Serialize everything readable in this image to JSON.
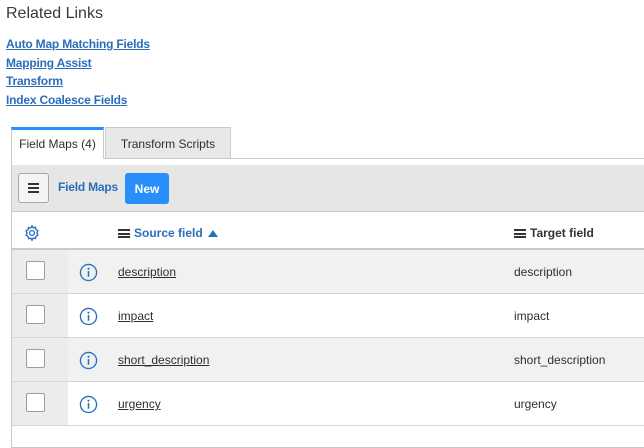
{
  "related": {
    "title": "Related Links",
    "links": [
      "Auto Map Matching Fields",
      "Mapping Assist",
      "Transform",
      "Index Coalesce Fields"
    ]
  },
  "tabs": [
    {
      "label": "Field Maps (4)",
      "active": true
    },
    {
      "label": "Transform Scripts",
      "active": false
    }
  ],
  "list": {
    "title": "Field Maps",
    "new_label": "New"
  },
  "columns": {
    "source": "Source field",
    "target": "Target field"
  },
  "rows": [
    {
      "source": "description",
      "target": "description"
    },
    {
      "source": "impact",
      "target": "impact"
    },
    {
      "source": "short_description",
      "target": "short_description"
    },
    {
      "source": "urgency",
      "target": "urgency"
    }
  ],
  "colors": {
    "accent": "#278efc",
    "link": "#2a6ebb"
  },
  "icons": {
    "menu": "hamburger-icon",
    "settings": "gear-icon",
    "info": "info-circle-icon",
    "sort": "sort-ascending-icon"
  }
}
